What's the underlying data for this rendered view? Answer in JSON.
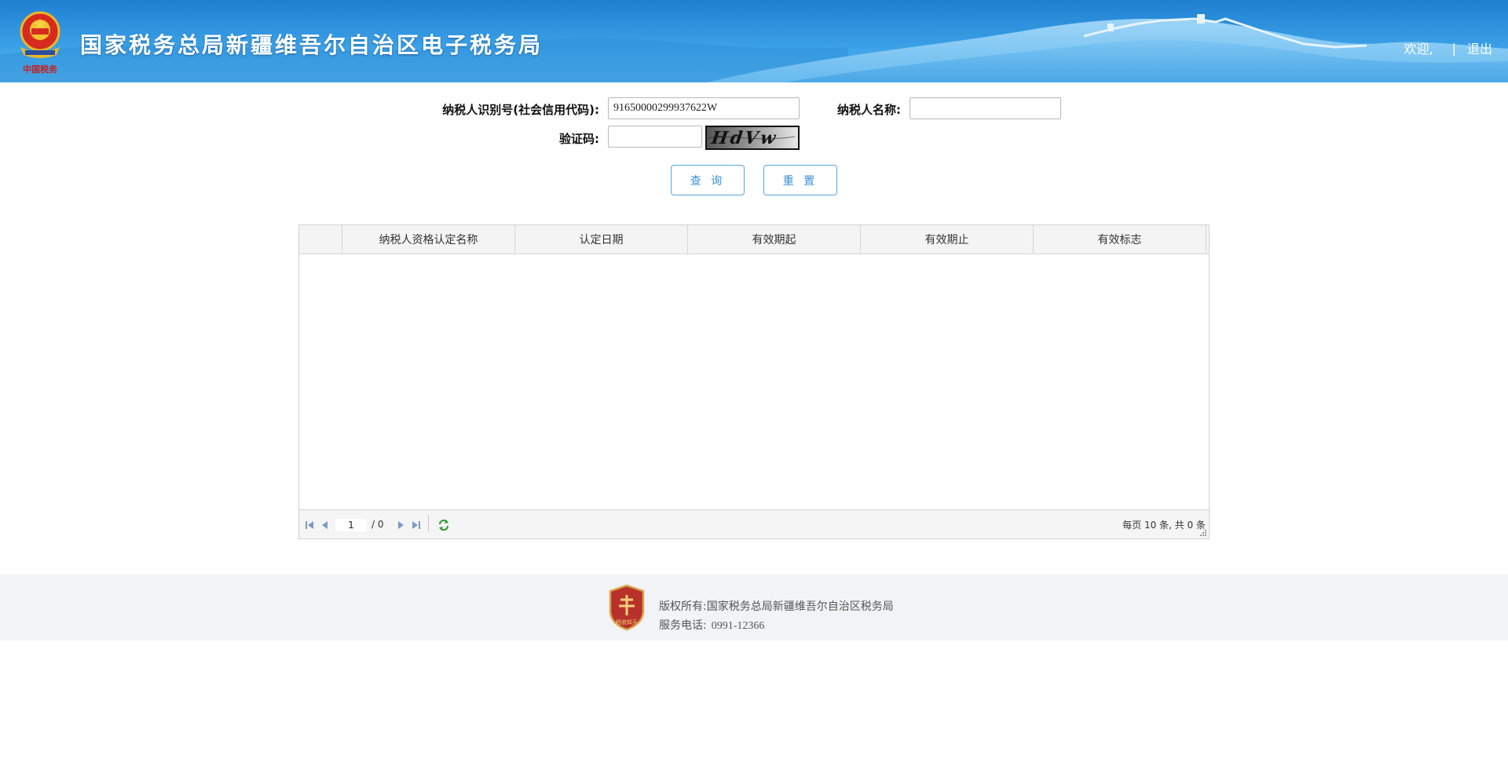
{
  "header": {
    "title": "国家税务总局新疆维吾尔自治区电子税务局",
    "welcome": "欢迎,",
    "separator": "|",
    "logout": "退出",
    "emblem_caption": "中国税务"
  },
  "form": {
    "taxpayer_id_label": "纳税人识别号(社会信用代码):",
    "taxpayer_id_value": "91650000299937622W",
    "taxpayer_name_label": "纳税人名称:",
    "taxpayer_name_value": "",
    "captcha_label": "验证码:",
    "captcha_value": "",
    "captcha_text": "HdVw",
    "query_button": "查 询",
    "reset_button": "重 置"
  },
  "grid": {
    "columns": [
      "",
      "纳税人资格认定名称",
      "认定日期",
      "有效期起",
      "有效期止",
      "有效标志"
    ],
    "rows": []
  },
  "pager": {
    "current_page": "1",
    "total_pages": "/ 0",
    "info": "每页 10 条, 共 0 条"
  },
  "footer": {
    "copyright_label": "版权所有:",
    "copyright_value": "国家税务总局新疆维吾尔自治区税务局",
    "phone_label": "服务电话:",
    "phone_value": "0991-12366",
    "badge_text": "税收知天"
  },
  "colors": {
    "header_blue": "#2a8fdc",
    "button_border": "#55a7e6",
    "button_text": "#3a8fd6",
    "footer_bg": "#f2f3f7"
  }
}
